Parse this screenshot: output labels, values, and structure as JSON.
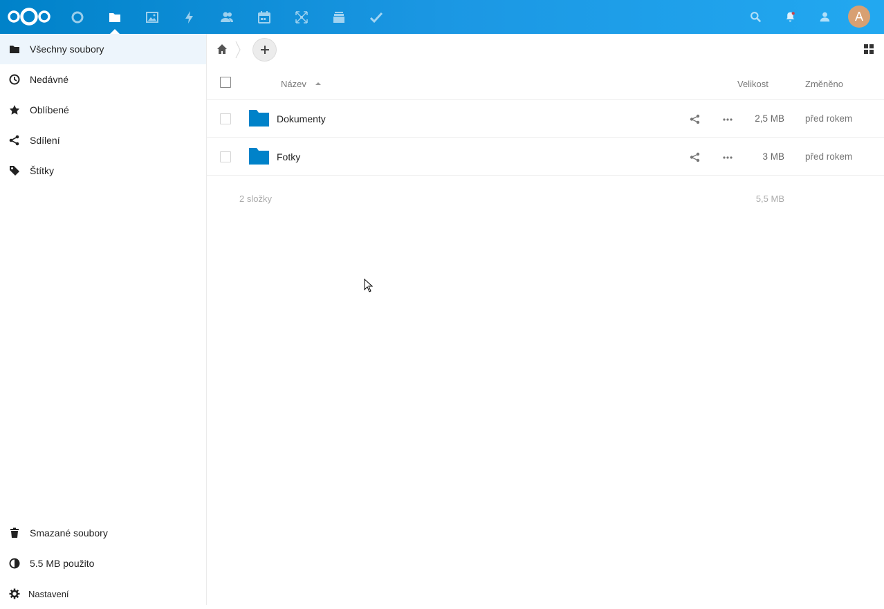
{
  "header": {
    "brand": "nextcloud",
    "apps": [
      {
        "name": "dashboard",
        "icon": "circle-icon"
      },
      {
        "name": "files",
        "icon": "folder-icon",
        "active": true
      },
      {
        "name": "photos",
        "icon": "image-icon"
      },
      {
        "name": "activity",
        "icon": "lightning-icon"
      },
      {
        "name": "contacts",
        "icon": "contacts-icon"
      },
      {
        "name": "calendar",
        "icon": "calendar-icon"
      },
      {
        "name": "maps",
        "icon": "network-icon"
      },
      {
        "name": "deck",
        "icon": "stack-icon"
      },
      {
        "name": "tasks",
        "icon": "checkmark-icon"
      }
    ],
    "avatar_letter": "A",
    "accent": "#0082c9"
  },
  "sidebar": {
    "items": [
      {
        "label": "Všechny soubory",
        "icon": "folder-icon",
        "active": true
      },
      {
        "label": "Nedávné",
        "icon": "clock-icon"
      },
      {
        "label": "Oblíbené",
        "icon": "star-icon"
      },
      {
        "label": "Sdílení",
        "icon": "share-icon"
      },
      {
        "label": "Štítky",
        "icon": "tag-icon"
      }
    ],
    "bottom": {
      "trash": "Smazané soubory",
      "quota": "5.5 MB použito",
      "settings": "Nastavení"
    }
  },
  "table": {
    "columns": {
      "name": "Název",
      "size": "Velikost",
      "modified": "Změněno"
    },
    "rows": [
      {
        "name": "Dokumenty",
        "size": "2,5 MB",
        "modified": "před rokem"
      },
      {
        "name": "Fotky",
        "size": "3 MB",
        "modified": "před rokem"
      }
    ],
    "summary": {
      "count": "2 složky",
      "total": "5,5 MB"
    }
  },
  "colors": {
    "folder": "#0082c9",
    "active_nav": "#edf5fc"
  }
}
